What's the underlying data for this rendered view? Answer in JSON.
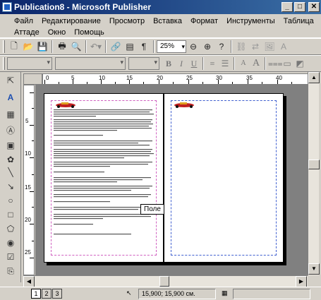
{
  "window": {
    "title": "Publication8 - Microsoft Publisher",
    "minimize": "_",
    "maximize": "□",
    "close": "✕"
  },
  "menu": [
    "Файл",
    "Редактирование",
    "Просмотр",
    "Вставка",
    "Формат",
    "Инструменты",
    "Таблица",
    "Аттаде",
    "Окно",
    "Помощь"
  ],
  "toolbar": {
    "zoom": "25%"
  },
  "ruler": {
    "h_numbers": [
      "0",
      "5",
      "10",
      "15",
      "20",
      "25",
      "30",
      "35",
      "40"
    ],
    "v_numbers": [
      "5",
      "10",
      "15",
      "20",
      "25"
    ]
  },
  "canvas": {
    "tooltip": "Поле"
  },
  "status": {
    "pages": [
      "1",
      "2",
      "3"
    ],
    "active_page": "1",
    "coordinates": "15,900; 15,900 см."
  },
  "icons": {
    "app": "publisher-icon",
    "new": "new-doc-icon",
    "open": "open-folder-icon",
    "save": "save-icon",
    "print": "print-icon",
    "preview": "print-preview-icon",
    "undo": "undo-icon",
    "zoom_out": "zoom-out-icon",
    "zoom_in": "zoom-in-icon"
  },
  "colors": {
    "title_start": "#0a246a",
    "title_end": "#3a6ea5",
    "margin_guide_left": "#d060c0",
    "margin_guide_right": "#4060d0"
  }
}
